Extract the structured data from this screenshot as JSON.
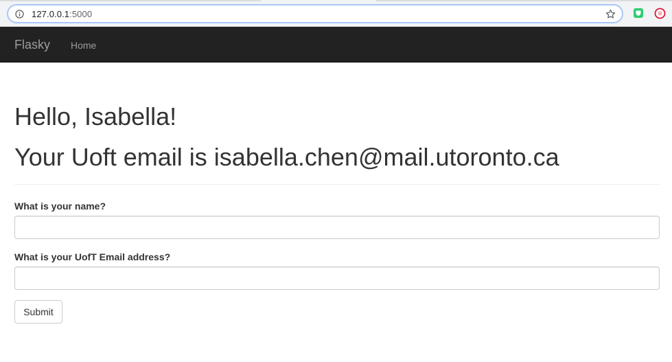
{
  "browser": {
    "url_host": "127.0.0.1",
    "url_port": ":5000",
    "icons": [
      "info-icon",
      "bookmark-star-icon",
      "extension-shield-icon",
      "extension-circle-icon"
    ]
  },
  "navbar": {
    "brand": "Flasky",
    "items": [
      {
        "label": "Home"
      }
    ],
    "background_color": "#222222"
  },
  "main": {
    "greeting": "Hello, Isabella!",
    "email_line": "Your Uoft email is isabella.chen@mail.utoronto.ca",
    "form": {
      "name_label": "What is your name?",
      "name_value": "",
      "email_label": "What is your UofT Email address?",
      "email_value": "",
      "submit_label": "Submit"
    }
  }
}
